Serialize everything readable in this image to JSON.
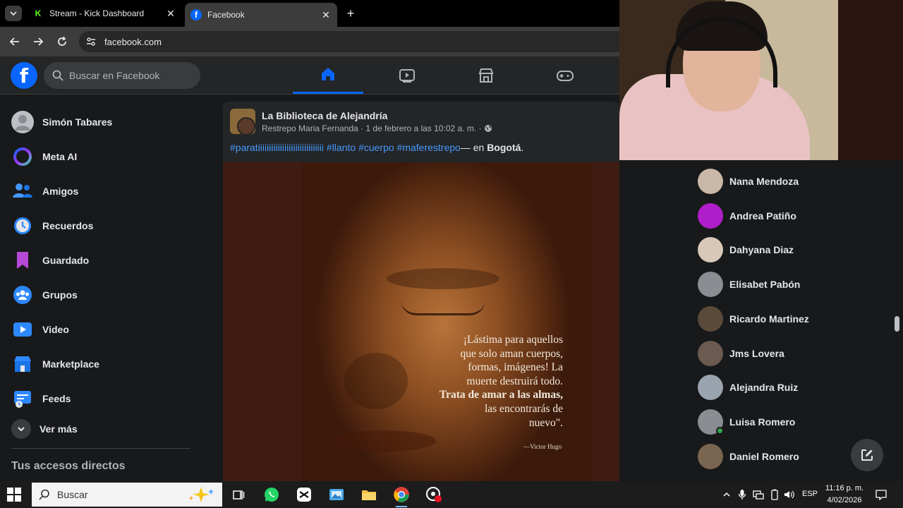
{
  "browser": {
    "tabs": [
      {
        "title": "Stream - Kick Dashboard",
        "icon": "kick-icon"
      },
      {
        "title": "Facebook",
        "icon": "facebook-icon"
      }
    ],
    "url": "facebook.com"
  },
  "header": {
    "search_placeholder": "Buscar en Facebook",
    "nav": [
      "home-icon",
      "video-icon",
      "marketplace-icon",
      "gaming-icon"
    ]
  },
  "sidebar": {
    "items": [
      {
        "label": "Simón Tabares"
      },
      {
        "label": "Meta AI"
      },
      {
        "label": "Amigos"
      },
      {
        "label": "Recuerdos"
      },
      {
        "label": "Guardado"
      },
      {
        "label": "Grupos"
      },
      {
        "label": "Video"
      },
      {
        "label": "Marketplace"
      },
      {
        "label": "Feeds"
      },
      {
        "label": "Ver más"
      }
    ],
    "section_title": "Tus accesos directos"
  },
  "post": {
    "page_name": "La Biblioteca de Alejandría",
    "author": "Restrepo Maria Fernanda",
    "separator": " · ",
    "date": "1 de febrero a las 10:02 a. m.",
    "audience_separator": " · ",
    "hashtags": [
      "#paratiiiiiiiiiiiiiiiiiiiiiiiiiiiiii",
      "#llanto",
      "#cuerpo",
      "#maferestrepo"
    ],
    "location_prefix": "— en ",
    "location": "Bogotá",
    "location_suffix": ".",
    "quote_lines": [
      "¡Lástima para aquellos",
      "que solo aman cuerpos,",
      "formas, imágenes! La",
      "muerte destruirá todo."
    ],
    "quote_bold": "Trata de amar a las almas,",
    "quote_end": [
      "las encontrarás de",
      "nuevo\"."
    ],
    "quote_author": "—Victor Hugo"
  },
  "contacts": [
    {
      "name": "Nana Mendoza",
      "color": "#c9b7a8",
      "online": false
    },
    {
      "name": "Andrea Patiño",
      "color": "#b01ec9",
      "online": false
    },
    {
      "name": "Dahyana Diaz",
      "color": "#d8c8b8",
      "online": false
    },
    {
      "name": "Elisabet Pabón",
      "color": "#8a8d91",
      "online": false
    },
    {
      "name": "Ricardo Martinez",
      "color": "#5a4a3a",
      "online": false
    },
    {
      "name": "Jms Lovera",
      "color": "#6b5a50",
      "online": false
    },
    {
      "name": "Alejandra Ruiz",
      "color": "#9aa4ae",
      "online": false
    },
    {
      "name": "Luisa Romero",
      "color": "#8a8d91",
      "online": true
    },
    {
      "name": "Daniel Romero",
      "color": "#7a6650",
      "online": false
    }
  ],
  "taskbar": {
    "search_placeholder": "Buscar",
    "language": "ESP",
    "time": "11:16 p. m.",
    "date": "4/02/2026"
  },
  "colors": {
    "accent": "#0866ff",
    "hashtag": "#4599ff"
  }
}
